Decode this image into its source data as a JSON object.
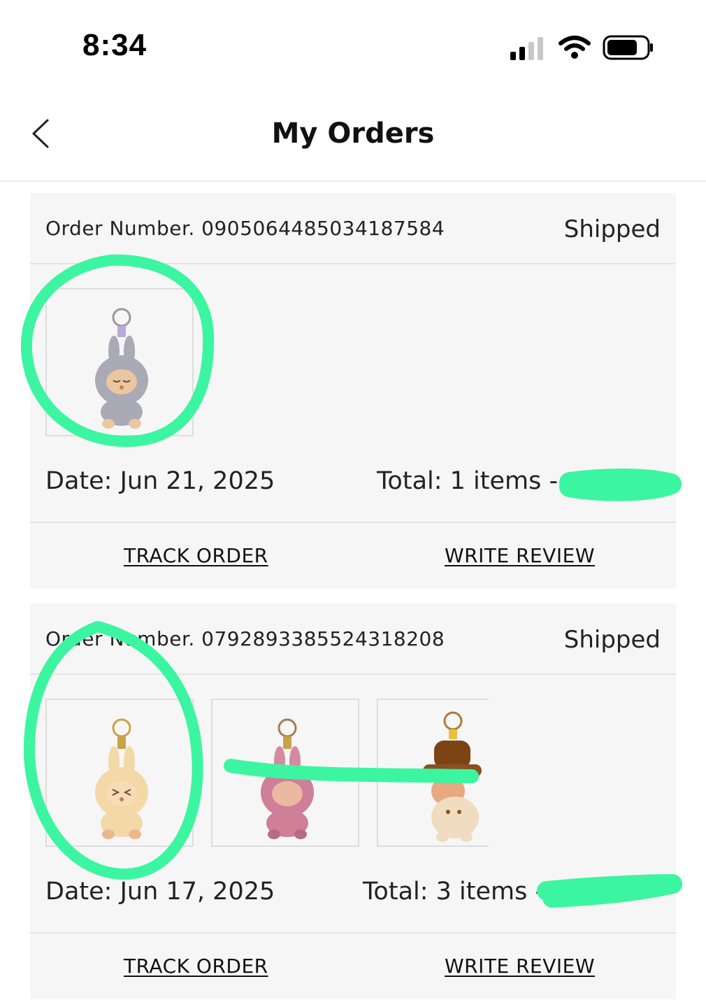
{
  "status_bar": {
    "time": "8:34",
    "icons": [
      "cellular-signal-icon",
      "wifi-icon",
      "battery-icon"
    ]
  },
  "header": {
    "title": "My Orders",
    "back_icon": "chevron-left-icon"
  },
  "orders": [
    {
      "order_number": "Order Number. 0905064485034187584",
      "status": "Shipped",
      "date": "Date: Jun 21, 2025",
      "total": "Total: 1 items -",
      "items": [
        {
          "name": "gray-plush-keychain"
        }
      ],
      "actions": {
        "track": "TRACK ORDER",
        "review": "WRITE REVIEW"
      }
    },
    {
      "order_number": "Order Number. 0792893385524318208",
      "status": "Shipped",
      "date": "Date: Jun 17, 2025",
      "total": "Total: 3 items -",
      "items": [
        {
          "name": "cream-plush-keychain"
        },
        {
          "name": "pink-plush-keychain"
        },
        {
          "name": "brown-hat-plush-keychain"
        }
      ],
      "actions": {
        "track": "TRACK ORDER",
        "review": "WRITE REVIEW"
      }
    }
  ],
  "colors": {
    "annotation": "#3cf5a0",
    "card_bg": "#f6f6f6",
    "divider": "#e4e4e4"
  }
}
